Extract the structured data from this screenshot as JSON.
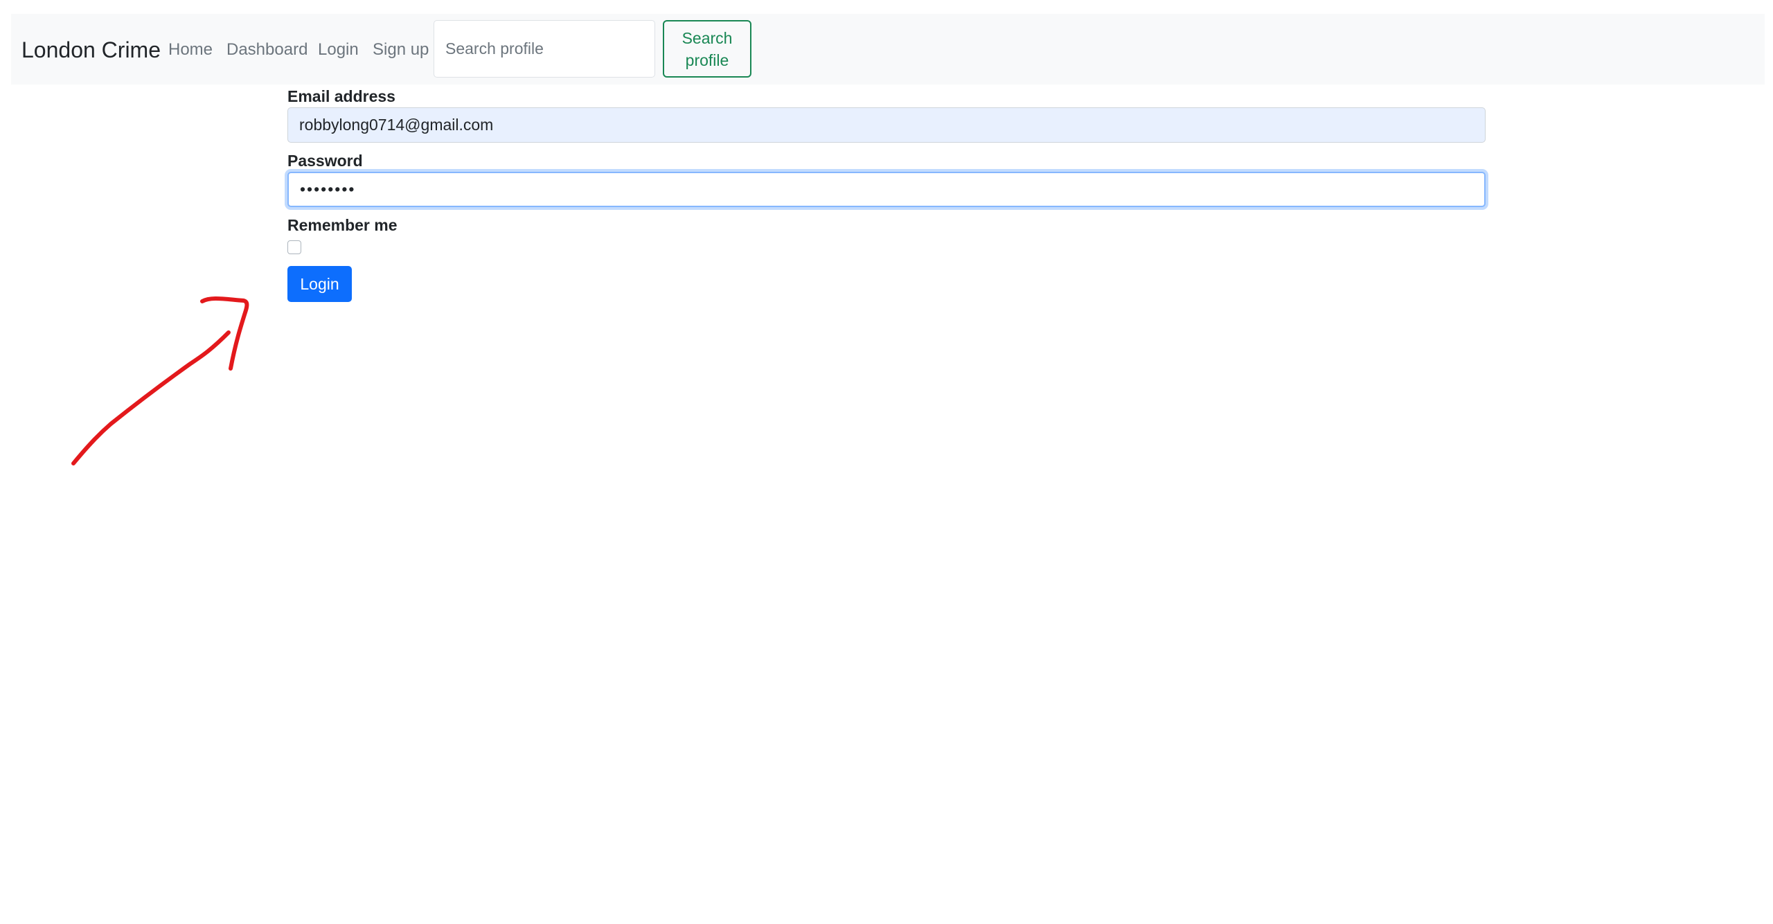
{
  "navbar": {
    "brand": "London Crime",
    "links": [
      {
        "label": "Home"
      },
      {
        "label": "Dashboard"
      },
      {
        "label": "Login"
      },
      {
        "label": "Sign up"
      }
    ],
    "search": {
      "placeholder": "Search profile",
      "value": "",
      "button_label": "Search profile"
    }
  },
  "form": {
    "email": {
      "label": "Email address",
      "value": "robbylong0714@gmail.com"
    },
    "password": {
      "label": "Password",
      "value": "12345678"
    },
    "remember": {
      "label": "Remember me",
      "checked": false
    },
    "submit_label": "Login"
  },
  "annotation": {
    "color": "#e3191c",
    "icon": "hand-drawn-arrow-icon"
  },
  "colors": {
    "primary": "#0d6efd",
    "success": "#198754",
    "navbar_bg": "#f8f9fa"
  }
}
